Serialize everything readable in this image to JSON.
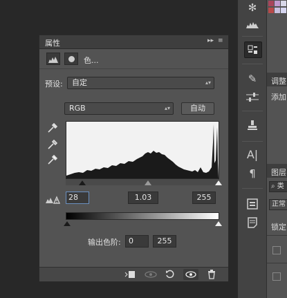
{
  "panel": {
    "tab_title": "属性",
    "adjustment_name": "色...",
    "preset_label": "预设:",
    "preset_value": "自定",
    "channel_value": "RGB",
    "auto_button": "自动",
    "input_black": "28",
    "input_gamma": "1.03",
    "input_white": "255",
    "output_label": "输出色阶:",
    "output_black": "0",
    "output_white": "255"
  },
  "right_panel": {
    "adjust_label": "调整",
    "add_label": "添加",
    "layers_label": "图层",
    "kind_label": "类",
    "blend_label": "正常",
    "lock_label": "锁定:"
  },
  "colors": {
    "panel_bg": "#535353",
    "histogram_bg": "#f2f2f2",
    "swatches": [
      "#a8455c",
      "#c29ad0",
      "#d8d8e8",
      "#b84a4a",
      "#c8c0e0",
      "#d6d6f0"
    ]
  },
  "icons": {
    "tool_strip": [
      "navigator-icon",
      "histogram-icon",
      "properties-icon",
      "brush-icon",
      "adjust-sliders-icon",
      "stamp-icon",
      "character-icon",
      "paragraph-icon",
      "notes-icon",
      "layers-icon"
    ],
    "bottom_bar": [
      "clip-to-layer-icon",
      "view-previous-icon",
      "reset-icon",
      "visibility-icon",
      "trash-icon"
    ]
  }
}
